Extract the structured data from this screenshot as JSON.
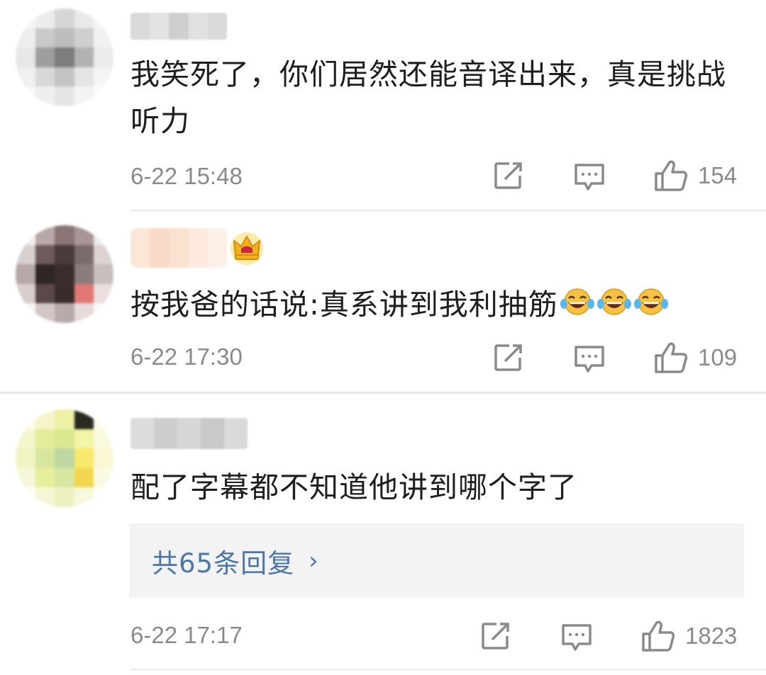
{
  "comments": [
    {
      "text": "我笑死了，你们居然还能音译出来，真是挑战听力",
      "time": "6-22 15:48",
      "likes": "154",
      "avatar_colors": [
        "#f4f4f4",
        "#ececec",
        "#d6d6d6",
        "#e9e9e9",
        "#f6f6f6",
        "#eeeeee",
        "#c9c9c9",
        "#bdbdbd",
        "#cfcfcf",
        "#f1f1f1",
        "#e7e7e7",
        "#9e9e9e",
        "#7d7d7d",
        "#b2b2b2",
        "#ebebeb",
        "#f0f0f0",
        "#d8d8d8",
        "#c3c3c3",
        "#e4e4e4",
        "#f5f5f5",
        "#f8f8f8",
        "#efefef",
        "#e6e6e6",
        "#f3f3f3",
        "#fafafa"
      ],
      "name_colors": [
        "#d9d9d9",
        "#e3e3e3",
        "#cfcfcf",
        "#e0e0e0",
        "#dadada"
      ]
    },
    {
      "text": "按我爸的话说:真系讲到我利抽筋",
      "time": "6-22 17:30",
      "likes": "109",
      "badge": "crown-icon",
      "avatar_colors": [
        "#f2eeee",
        "#b9a8a8",
        "#8a7474",
        "#a89696",
        "#efe9e9",
        "#d8cfcf",
        "#6e5a5a",
        "#4a3a3a",
        "#7c6b6b",
        "#dcd3d3",
        "#b6a8a8",
        "#2f2626",
        "#3b2d2d",
        "#8a7c7c",
        "#c9bfbf",
        "#d8cccc",
        "#5b4848",
        "#3a2c2c",
        "#e27873",
        "#eadede",
        "#f6f2f2",
        "#d2c6c6",
        "#b9aaaa",
        "#e6dada",
        "#faf7f7"
      ],
      "name_colors": [
        "#fbe6d8",
        "#f9dac8",
        "#fbe1cf",
        "#fde9dd",
        "#fcefe6"
      ]
    },
    {
      "text": "配了字幕都不知道他讲到哪个字了",
      "time": "6-22 17:17",
      "likes": "1823",
      "reply_summary": "共65条回复",
      "avatar_colors": [
        "#fbfbe6",
        "#f5f5c9",
        "#eef0a3",
        "#2a2a20",
        "#fbfbe8",
        "#f4f6cc",
        "#e4ec9a",
        "#dbe890",
        "#f2f4a6",
        "#fafadd",
        "#f1f4c2",
        "#d7e69b",
        "#bfd7a2",
        "#f7e96b",
        "#f9f7d4",
        "#f6f6d8",
        "#e6ee9a",
        "#d6e8a0",
        "#f3d650",
        "#fafae2",
        "#fdfdf0",
        "#f6f6d6",
        "#eef0c0",
        "#f8f8dc",
        "#fefef6"
      ],
      "name_colors": [
        "#dcdcdc",
        "#cdcdcd",
        "#d6d6d6",
        "#c9c9c9",
        "#dadada"
      ]
    }
  ],
  "icons": {
    "repost": "repost-icon",
    "reply": "comment-icon",
    "like": "thumbs-up-icon",
    "emoji": "laughing-tears-emoji",
    "chevron": "chevron-right-icon"
  },
  "colors": {
    "link": "#4d76a8",
    "meta": "#8a8a8a",
    "reply_bg": "#f3f3f3"
  }
}
